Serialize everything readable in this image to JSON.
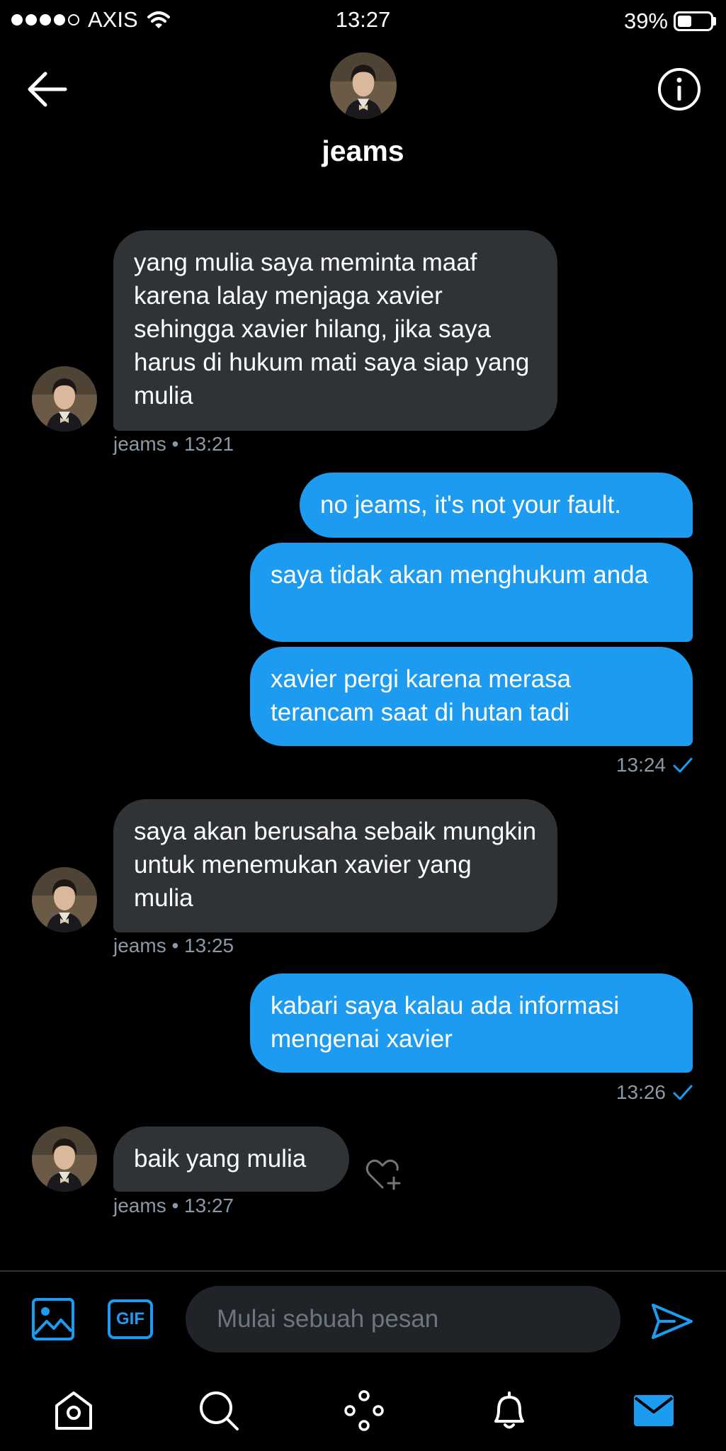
{
  "status_bar": {
    "carrier": "AXIS",
    "time": "13:27",
    "battery": "39%"
  },
  "header": {
    "name": "jeams"
  },
  "messages": [
    {
      "side": "received",
      "text": "yang mulia saya meminta maaf karena lalay menjaga xavier sehingga xavier hilang, jika saya harus di hukum mati saya siap yang mulia",
      "meta": "jeams • 13:21"
    },
    {
      "side": "sent",
      "text": "no jeams, it's not your fault."
    },
    {
      "side": "sent",
      "text": "saya tidak akan menghukum anda"
    },
    {
      "side": "sent",
      "text": "xavier pergi karena merasa terancam saat di hutan tadi",
      "meta": "13:24"
    },
    {
      "side": "received",
      "text": "saya akan berusaha sebaik mungkin untuk menemukan xavier yang mulia",
      "meta": "jeams • 13:25"
    },
    {
      "side": "sent",
      "text": "kabari saya kalau ada informasi mengenai xavier",
      "meta": "13:26"
    },
    {
      "side": "received",
      "text": "baik yang mulia",
      "meta": "jeams • 13:27"
    }
  ],
  "composer": {
    "placeholder": "Mulai sebuah pesan",
    "gif_label": "GIF"
  },
  "colors": {
    "accent": "#1d9bf0",
    "received_bubble": "#2f3336",
    "background": "#000000"
  },
  "icons": [
    "back-arrow-icon",
    "info-icon",
    "image-icon",
    "gif-icon",
    "send-icon",
    "home-icon",
    "search-icon",
    "spaces-icon",
    "notifications-icon",
    "messages-icon",
    "heart-add-icon",
    "check-icon",
    "wifi-icon",
    "battery-icon"
  ]
}
